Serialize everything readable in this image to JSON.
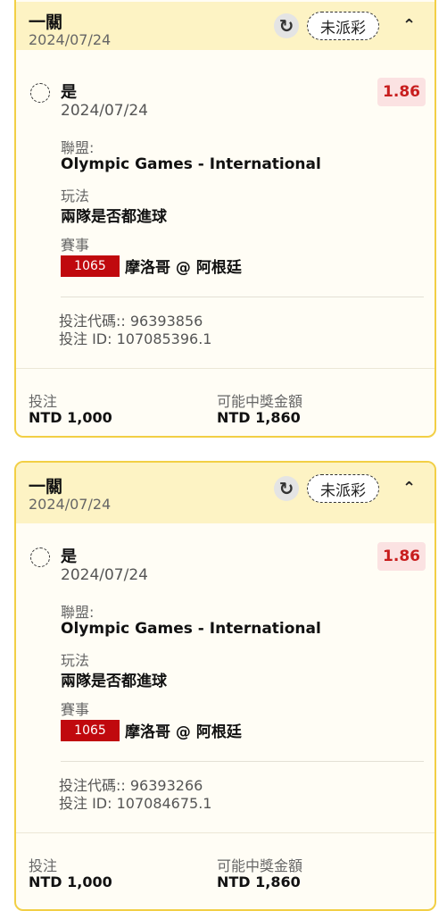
{
  "bets": [
    {
      "bet_type": "一關",
      "date": "2024/07/24",
      "status": "未派彩",
      "selection": "是",
      "selection_date": "2024/07/24",
      "odds": "1.86",
      "league_label": "聯盟:",
      "league": "Olympic Games - International",
      "market_label": "玩法",
      "market": "兩隊是否都進球",
      "event_label": "賽事",
      "event_id": "1065",
      "event_name": "摩洛哥 @ 阿根廷",
      "bet_code": "投注代碼:: 96393856",
      "bet_id": "投注 ID: 107085396.1",
      "stake_label": "投注",
      "stake": "NTD 1,000",
      "payout_label": "可能中獎金額",
      "payout": "NTD 1,860"
    },
    {
      "bet_type": "一關",
      "date": "2024/07/24",
      "status": "未派彩",
      "selection": "是",
      "selection_date": "2024/07/24",
      "odds": "1.86",
      "league_label": "聯盟:",
      "league": "Olympic Games - International",
      "market_label": "玩法",
      "market": "兩隊是否都進球",
      "event_label": "賽事",
      "event_id": "1065",
      "event_name": "摩洛哥 @ 阿根廷",
      "bet_code": "投注代碼:: 96393266",
      "bet_id": "投注 ID: 107084675.1",
      "stake_label": "投注",
      "stake": "NTD 1,000",
      "payout_label": "可能中獎金額",
      "payout": "NTD 1,860"
    }
  ],
  "icons": {
    "refresh": "refresh-icon",
    "collapse": "chevron-up-icon",
    "radio": "radio-icon"
  },
  "colors": {
    "border": "#f2cf45",
    "header_bg": "#fdf3c4",
    "odds_text": "#c81e1e",
    "event_badge": "#c0090e"
  }
}
